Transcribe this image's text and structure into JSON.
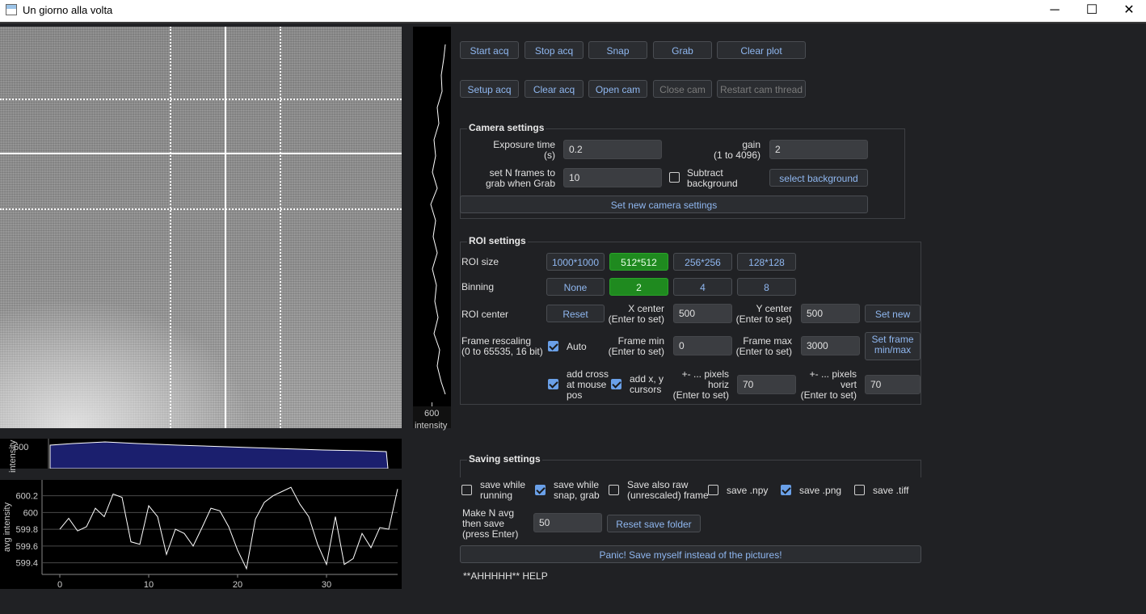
{
  "window": {
    "title": "Un giorno alla volta",
    "minimize_glyph": "─",
    "maximize_glyph": "☐",
    "close_glyph": "✕"
  },
  "row1": {
    "start_acq": "Start acq",
    "stop_acq": "Stop acq",
    "snap": "Snap",
    "grab": "Grab",
    "clear_plot": "Clear plot"
  },
  "row2": {
    "setup_acq": "Setup acq",
    "clear_acq": "Clear acq",
    "open_cam": "Open cam",
    "close_cam": "Close cam",
    "restart_cam_thread": "Restart cam thread"
  },
  "camera_settings": {
    "title": "Camera settings",
    "exposure_label_1": "Exposure time",
    "exposure_label_2": "(s)",
    "exposure_value": "0.2",
    "gain_label_1": "gain",
    "gain_label_2": "(1 to 4096)",
    "gain_value": "2",
    "nframes_label_1": "set N frames to",
    "nframes_label_2": "grab when Grab",
    "nframes_value": "10",
    "subtract_label_1": "Subtract",
    "subtract_label_2": "background",
    "subtract_checked": false,
    "select_background": "select background",
    "set_new": "Set new camera settings"
  },
  "roi_settings": {
    "title": "ROI settings",
    "roi_size_label": "ROI size",
    "roi_sizes": [
      "1000*1000",
      "512*512",
      "256*256",
      "128*128"
    ],
    "roi_selected": "512*512",
    "binning_label": "Binning",
    "binnings": [
      "None",
      "2",
      "4",
      "8"
    ],
    "binning_selected": "2",
    "roi_center_label": "ROI center",
    "reset": "Reset",
    "x_center_1": "X center",
    "x_center_2": "(Enter to set)",
    "x_center_value": "500",
    "y_center_1": "Y center",
    "y_center_2": "(Enter to set)",
    "y_center_value": "500",
    "set_new": "Set new",
    "rescale_1": "Frame rescaling",
    "rescale_2": "(0 to 65535, 16 bit)",
    "auto_label": "Auto",
    "auto_checked": true,
    "fmin_1": "Frame min",
    "fmin_2": "(Enter to set)",
    "fmin_value": "0",
    "fmax_1": "Frame max",
    "fmax_2": "(Enter to set)",
    "fmax_value": "3000",
    "set_frame_1": "Set frame",
    "set_frame_2": "min/max",
    "cross_1": "add cross",
    "cross_2": "at mouse",
    "cross_3": "pos",
    "cross_checked": true,
    "cursors_1": "add x, y",
    "cursors_2": "cursors",
    "cursors_checked": true,
    "horiz_1": "+- ... pixels",
    "horiz_2": "horiz",
    "horiz_3": "(Enter to set)",
    "horiz_value": "70",
    "vert_1": "+- ... pixels",
    "vert_2": "vert",
    "vert_3": "(Enter to set)",
    "vert_value": "70"
  },
  "saving_settings": {
    "title": "Saving settings",
    "while_running_1": "save while",
    "while_running_2": "running",
    "while_running_checked": false,
    "snap_grab_1": "save while",
    "snap_grab_2": "snap, grab",
    "snap_grab_checked": true,
    "raw_1": "Save also raw",
    "raw_2": "(unrescaled) frame",
    "raw_checked": false,
    "npy": "save .npy",
    "npy_checked": false,
    "png": "save .png",
    "png_checked": true,
    "tiff": "save .tiff",
    "tiff_checked": false,
    "navg_1": "Make N avg",
    "navg_2": "then save",
    "navg_3": "(press Enter)",
    "navg_value": "50",
    "reset_folder": "Reset save folder",
    "panic": "Panic! Save myself instead of the pictures!",
    "help": "**AHHHHH** HELP"
  },
  "side_profile": {
    "tick": "600",
    "label": "intensity"
  },
  "bottom_profile": {
    "tick": "600",
    "label": "intensity"
  },
  "chart_data": {
    "type": "line",
    "ylabel": "avg intensity",
    "xlim": [
      -2,
      38
    ],
    "ylim": [
      599.3,
      600.35
    ],
    "xticks": [
      "0",
      "10",
      "20",
      "30"
    ],
    "yticks": [
      "600.2",
      "600",
      "599.8",
      "599.6",
      "599.4"
    ],
    "x": [
      0,
      1,
      2,
      3,
      4,
      5,
      6,
      7,
      8,
      9,
      10,
      11,
      12,
      13,
      14,
      15,
      16,
      17,
      18,
      19,
      20,
      21,
      22,
      23,
      24,
      25,
      26,
      27,
      28,
      29,
      30,
      31,
      32,
      33,
      34,
      35,
      36,
      37,
      38
    ],
    "values": [
      599.8,
      599.93,
      599.78,
      599.83,
      600.05,
      599.95,
      600.22,
      600.18,
      599.65,
      599.62,
      600.08,
      599.95,
      599.5,
      599.8,
      599.75,
      599.6,
      599.82,
      600.05,
      600.02,
      599.83,
      599.55,
      599.33,
      599.92,
      600.12,
      600.2,
      600.25,
      600.3,
      600.1,
      599.95,
      599.62,
      599.38,
      599.95,
      599.38,
      599.45,
      599.75,
      599.58,
      599.82,
      599.8,
      600.28
    ]
  }
}
